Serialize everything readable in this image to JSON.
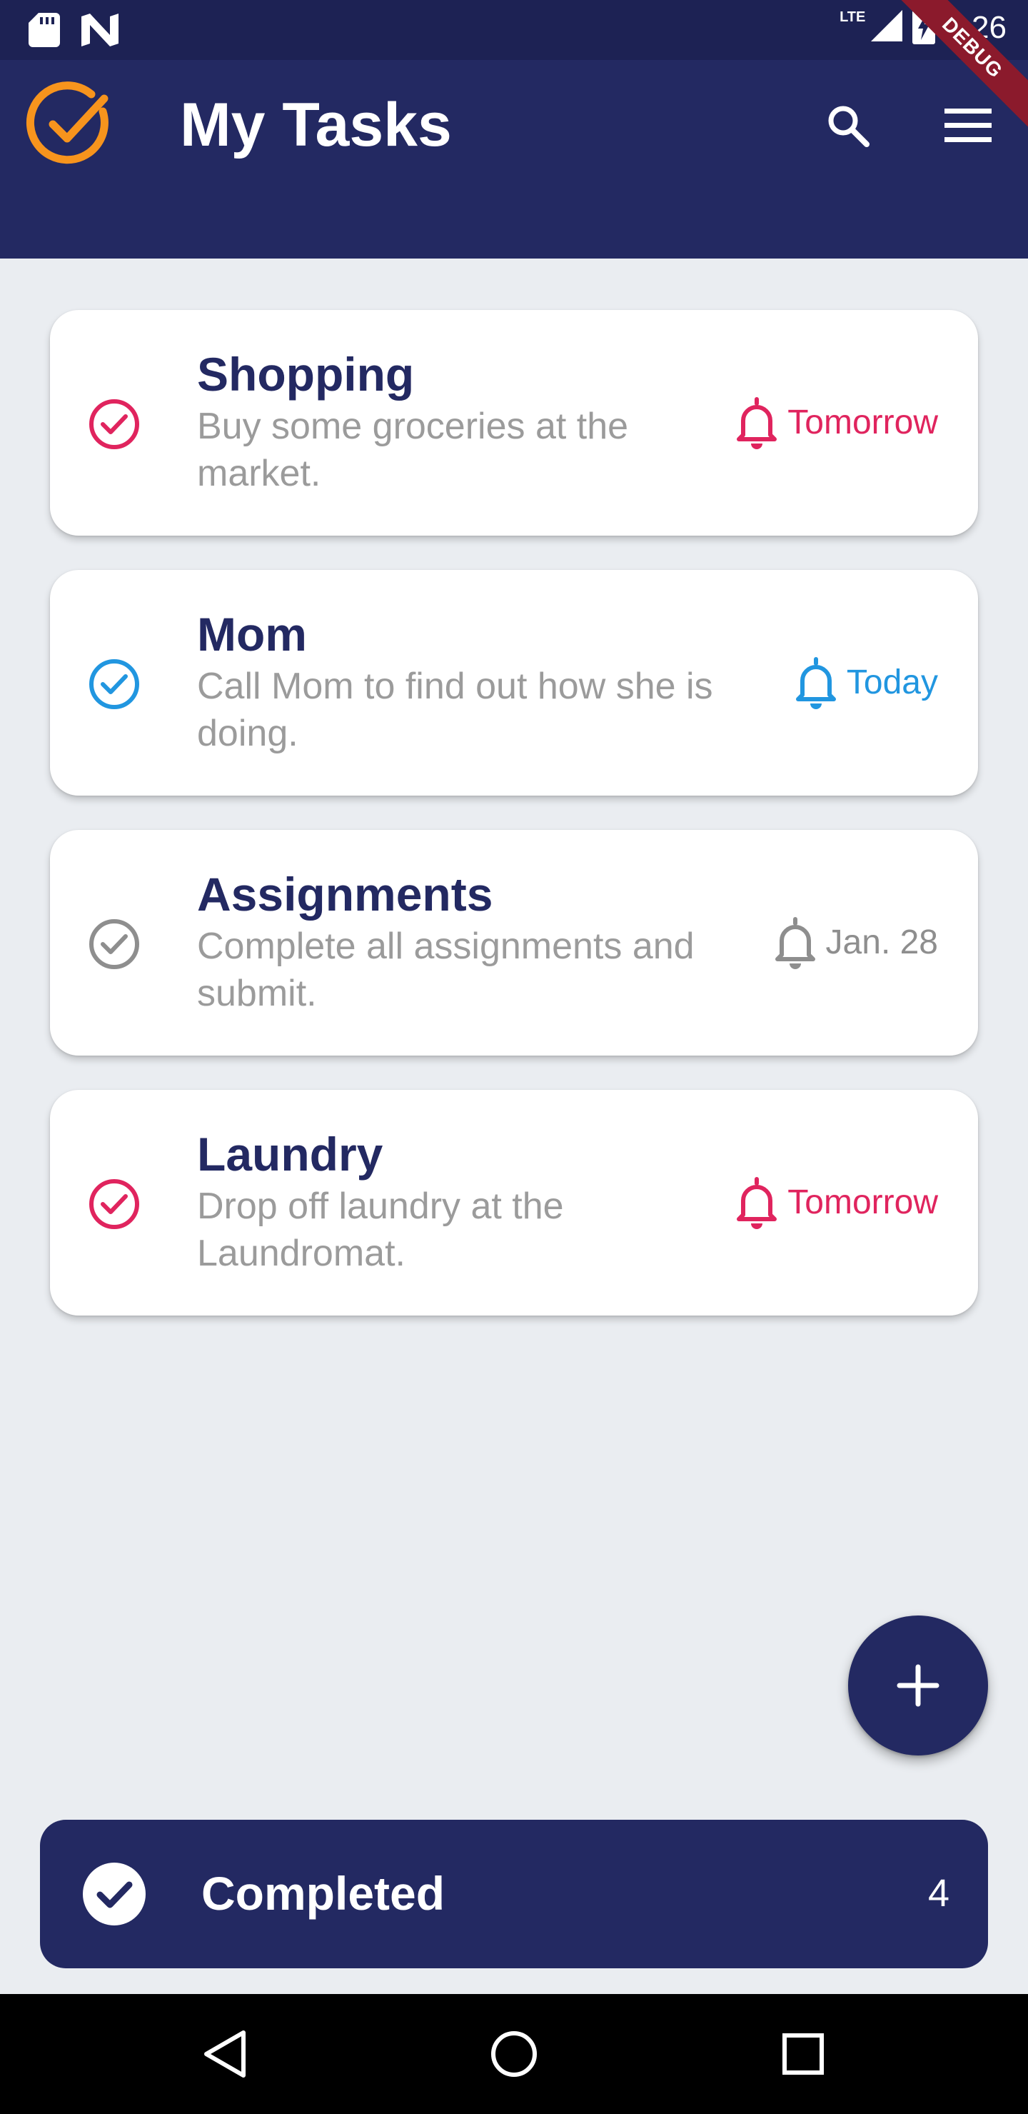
{
  "status_bar": {
    "time": "1:26",
    "network_label": "LTE",
    "icons": [
      "sd-card-icon",
      "n-notification-icon",
      "signal-icon",
      "battery-charging-icon"
    ]
  },
  "debug_banner": "DEBUG",
  "app_bar": {
    "title": "My Tasks",
    "logo_icon": "check-circle-logo-icon",
    "actions": [
      "search-icon",
      "menu-icon"
    ]
  },
  "colors": {
    "primary": "#232962",
    "status_bar": "#1d2254",
    "background": "#eaedf1",
    "logo_accent": "#f7941d",
    "pink": "#e0245e",
    "blue": "#2196e0",
    "grey": "#8e8e8e",
    "desc_grey": "#9b9b9b"
  },
  "tasks": [
    {
      "title": "Shopping",
      "description": "Buy some groceries at the market.",
      "reminder": "Tomorrow",
      "color": "#e0245e"
    },
    {
      "title": "Mom",
      "description": "Call Mom to find out how she is doing.",
      "reminder": "Today",
      "color": "#2196e0"
    },
    {
      "title": "Assignments",
      "description": "Complete all assignments and submit.",
      "reminder": "Jan. 28",
      "color": "#8e8e8e"
    },
    {
      "title": "Laundry",
      "description": "Drop off laundry at the Laundromat.",
      "reminder": "Tomorrow",
      "color": "#e0245e"
    }
  ],
  "fab": {
    "icon": "plus-icon"
  },
  "completed": {
    "label": "Completed",
    "count": "4"
  },
  "nav_bar": {
    "buttons": [
      "back-icon",
      "home-icon",
      "recents-icon"
    ]
  }
}
